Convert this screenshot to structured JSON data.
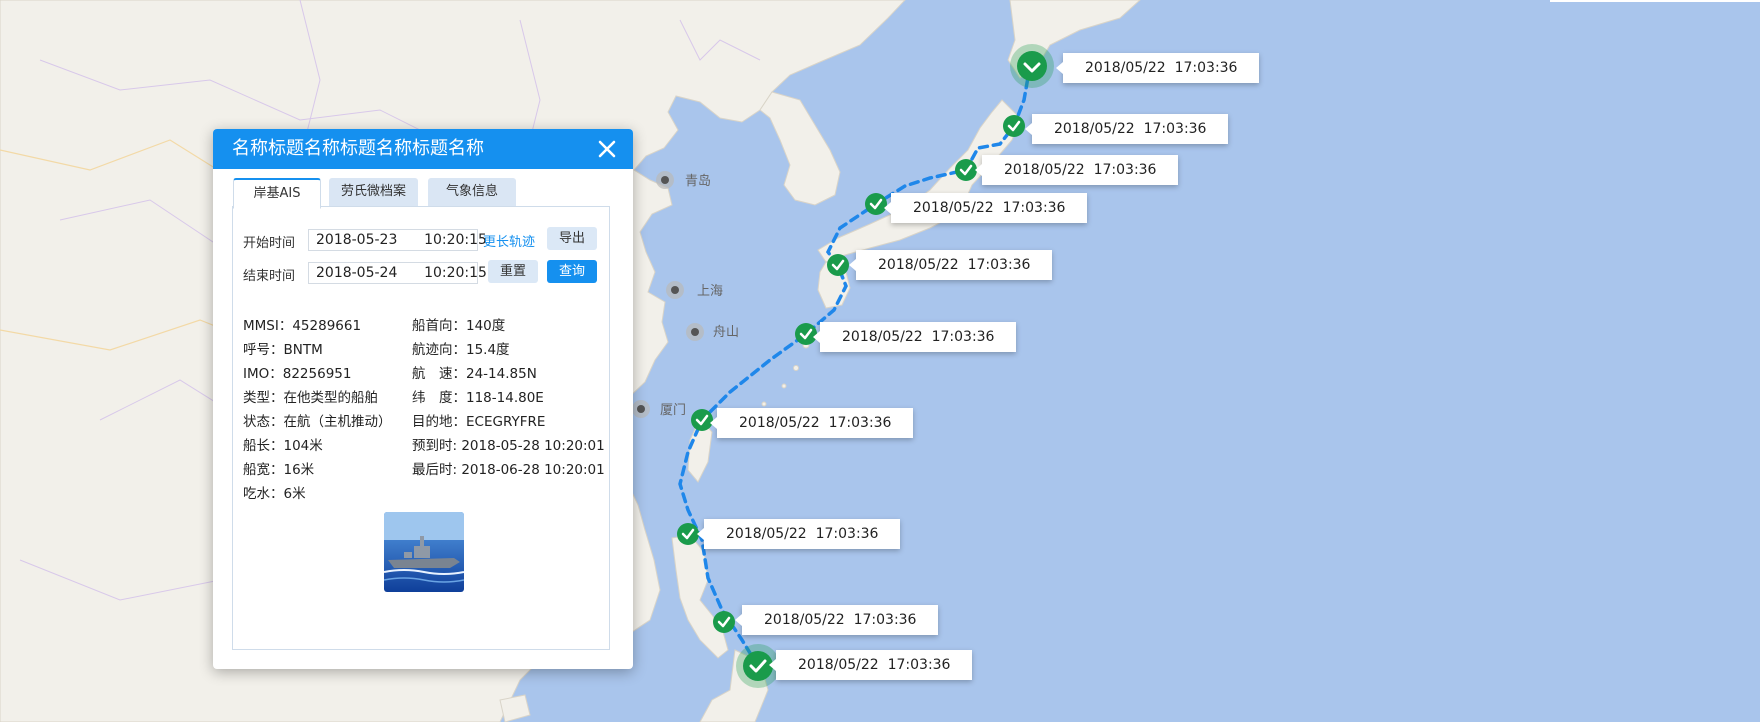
{
  "panel": {
    "title": "名称标题名称标题名称标题名称",
    "tabs": [
      {
        "label": "岸基AIS",
        "active": true
      },
      {
        "label": "劳氏微档案",
        "active": false
      },
      {
        "label": "气象信息",
        "active": false
      }
    ],
    "query": {
      "start_label": "开始时间",
      "start_value": "2018-05-23      10:20:15",
      "end_label": "结束时间",
      "end_value": "2018-05-24      10:20:15",
      "more_track_link": "更长轨迹",
      "export_button": "导出",
      "reset_button": "重置",
      "search_button": "查询"
    },
    "info_left": [
      "MMSI：45289661",
      "呼号：BNTM",
      "IMO：82256951",
      "类型：在他类型的船舶",
      "状态：在航（主机推动）",
      "船长：104米",
      "船宽：16米",
      "吃水：6米"
    ],
    "info_right": [
      "船首向：140度",
      "航迹向：15.4度",
      "航　速：24-14.85N",
      "纬　度：118-14.80E",
      "目的地：ECEGRYFRE",
      "预到时: 2018-05-28  10:20:01",
      "最后时: 2018-06-28  10:20:01"
    ]
  },
  "map": {
    "cities": [
      "青岛",
      "上海",
      "舟山",
      "厦门"
    ],
    "track_points": [
      {
        "time": "2018/05/22  17:03:36"
      },
      {
        "time": "2018/05/22  17:03:36"
      },
      {
        "time": "2018/05/22  17:03:36"
      },
      {
        "time": "2018/05/22  17:03:36"
      },
      {
        "time": "2018/05/22  17:03:36"
      },
      {
        "time": "2018/05/22  17:03:36"
      },
      {
        "time": "2018/05/22  17:03:36"
      },
      {
        "time": "2018/05/22  17:03:36"
      },
      {
        "time": "2018/05/22  17:03:36"
      },
      {
        "time": "2018/05/22  17:03:36"
      }
    ],
    "colors": {
      "sea": "#a9c5ec",
      "land": "#f2f0ea",
      "track": "#1f87ea",
      "marker": "#1a9b4b"
    }
  },
  "icons": {
    "close": "close-icon",
    "marker": "check-marker-icon",
    "city": "city-dot-icon",
    "photo": "ship-photo"
  }
}
